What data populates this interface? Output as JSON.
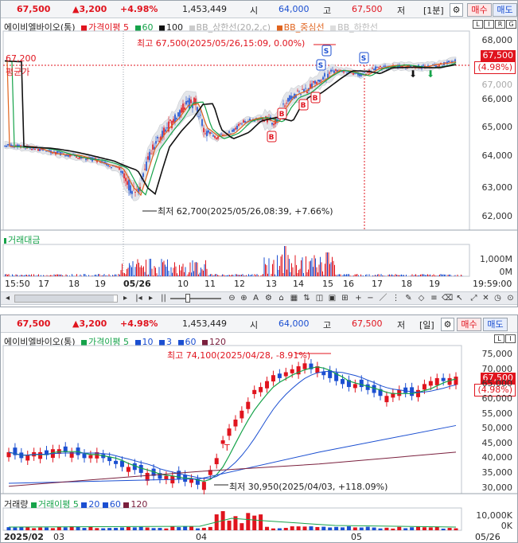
{
  "quote": {
    "price": "67,500",
    "change": "▲3,200",
    "rate": "+4.98%",
    "volume": "1,453,449",
    "open_label": "시",
    "open": "64,000",
    "high_label": "고",
    "high": "67,500",
    "low_label": "저"
  },
  "buttons": {
    "buy": "매수",
    "sell": "매도",
    "gear": "⚙"
  },
  "intraday": {
    "period": "[1분]",
    "stock": "에이비엘바이오(통)",
    "ma_label": "가격이평 5",
    "ma2": "60",
    "ma3": "100",
    "bb_upper": "BB_상한선(20,2,c)",
    "bb_mid": "BB_중심선",
    "bb_lower": "BB_하한선",
    "high_note": "최고 67,500(2025/05/26,15:09, 0.00%)",
    "low_note": "최저 62,700(2025/05/26,08:39, +7.66%)",
    "avg_price": "67,200",
    "avg_label": "평균가",
    "price_tag": "67,500",
    "pct_tag": "(4.98%)",
    "y_ticks": [
      "68,000",
      "67,000",
      "66,000",
      "65,000",
      "64,000",
      "63,000",
      "62,000"
    ],
    "vol_label": "거래대금",
    "vol_ticks": [
      "1,000M",
      "0M"
    ],
    "x_ticks": [
      "15:50",
      "17",
      "18",
      "19",
      "05/26",
      "10",
      "11",
      "12",
      "13",
      "14",
      "15",
      "16",
      "17",
      "18",
      "19",
      "19:59:00"
    ],
    "signals": [
      "B",
      "B",
      "B",
      "B",
      "S",
      "S",
      "S"
    ],
    "controls": [
      "L",
      "I",
      "R",
      "G"
    ]
  },
  "daily": {
    "period": "[일]",
    "stock": "에이비엘바이오(통)",
    "ma_label": "가격이평 5",
    "ma2": "10",
    "ma3": "3",
    "ma4": "60",
    "ma5": "120",
    "high_note": "최고 74,100(2025/04/28, -8.91%)",
    "low_note": "최저 30,950(2025/04/03, +118.09%)",
    "price_tag": "67,500",
    "pct_tag": "(4.98%)",
    "y_ticks": [
      "75,000",
      "70,000",
      "65,000",
      "60,000",
      "55,000",
      "50,000",
      "45,000",
      "40,000",
      "35,000",
      "30,000"
    ],
    "vol_label": "거래량",
    "vol_ma": "거래이평 5",
    "vol_ma2": "20",
    "vol_ma3": "60",
    "vol_ma4": "120",
    "vol_ticks": [
      "10,000K",
      "0K"
    ],
    "x_ticks": [
      "2025/02",
      "03",
      "04",
      "05",
      "05/26"
    ],
    "marker": "T"
  },
  "colors": {
    "up": "#e0141e",
    "down": "#1b4fd1",
    "ma5": "#e0141e",
    "ma60": "#16a34a",
    "ma100": "#111111",
    "ma120": "#7a1f3d"
  }
}
